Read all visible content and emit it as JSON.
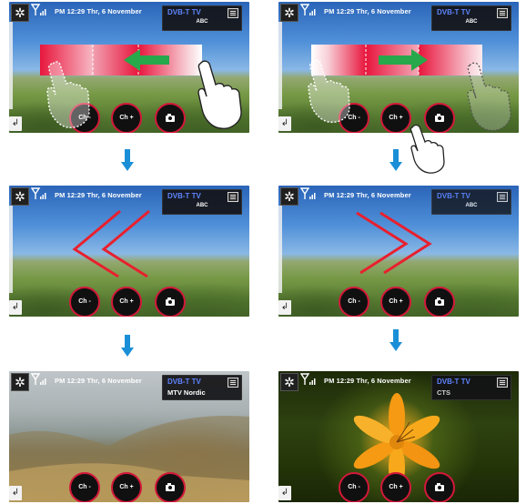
{
  "status": {
    "time_text": "PM 12:29 Thr, 6 November"
  },
  "panels": [
    {
      "channel_type": "DVB-T TV",
      "channel_name": "ABC"
    },
    {
      "channel_type": "DVB-T TV",
      "channel_name": "ABC"
    },
    {
      "channel_type": "DVB-T TV",
      "channel_name": "ABC"
    },
    {
      "channel_type": "DVB-T TV",
      "channel_name": "ABC"
    },
    {
      "channel_type": "DVB-T TV",
      "channel_name": "MTV Nordic"
    },
    {
      "channel_type": "DVB-T TV",
      "channel_name": "CTS"
    }
  ],
  "controls": {
    "ch_minus": "Ch -",
    "ch_plus": "Ch +"
  },
  "icons": {
    "settings": "gear-icon",
    "signal": "signal-icon",
    "menu": "menu-icon",
    "camera": "camera-icon",
    "back": "back-icon",
    "flow_arrow": "down-arrow-icon",
    "gesture": "hand-icon"
  },
  "colors": {
    "accent_red": "#d3183a",
    "channel_label_blue": "#5f84ff",
    "flow_arrow_blue": "#1a8fd8",
    "swipe_arrow_green": "#27a84a"
  }
}
